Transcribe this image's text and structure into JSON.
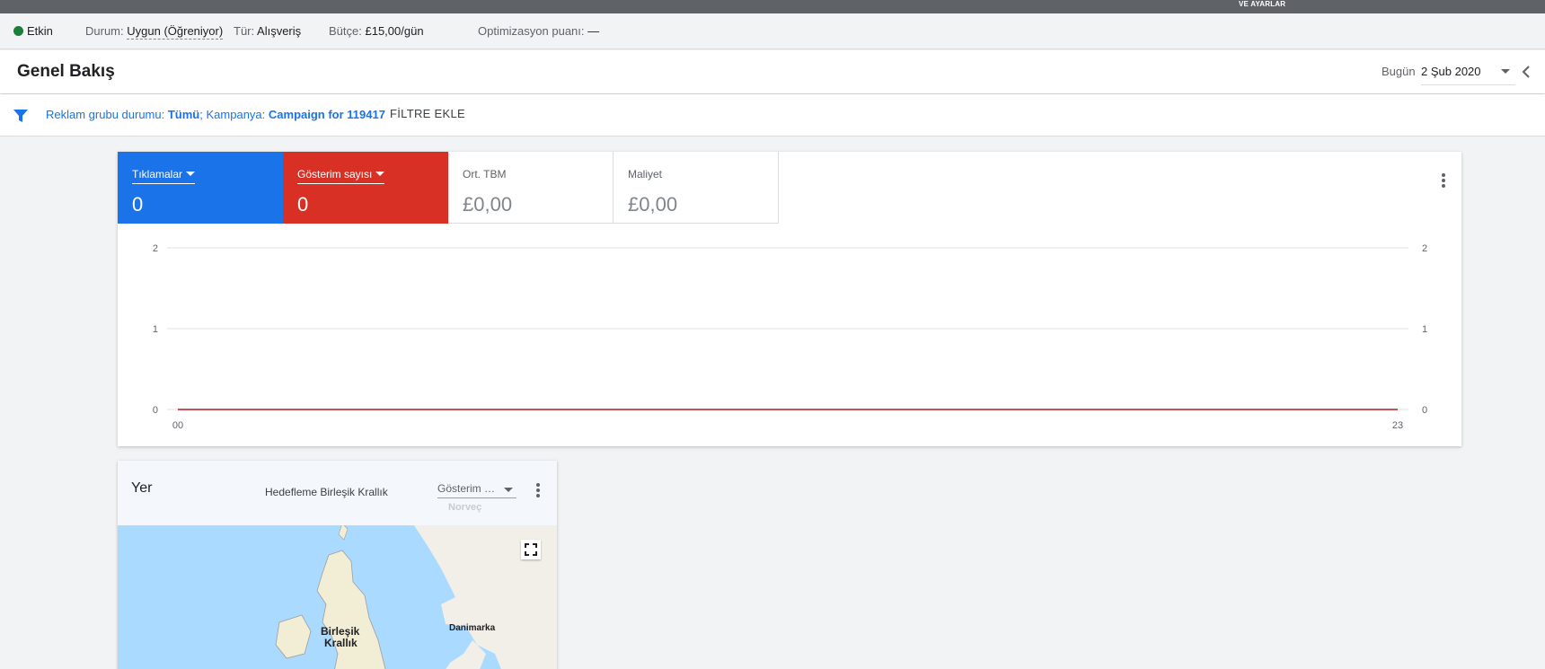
{
  "topbar": {
    "settings_label": "VE AYARLAR"
  },
  "status": {
    "state": "Etkin",
    "state_color": "#188038",
    "durum_label": "Durum:",
    "durum_value": "Uygun (Öğreniyor)",
    "tur_label": "Tür:",
    "tur_value": "Alışveriş",
    "butce_label": "Bütçe:",
    "butce_value": "£15,00/gün",
    "opt_label": "Optimizasyon puanı:",
    "opt_value": "—"
  },
  "header": {
    "title": "Genel Bakış",
    "today_label": "Bugün",
    "date_value": "2 Şub 2020"
  },
  "filter": {
    "ad_group_label": "Reklam grubu durumu:",
    "ad_group_value": "Tümü",
    "sep": ";",
    "campaign_label": "Kampanya:",
    "campaign_value": "Campaign for 119417",
    "add_filter": "FİLTRE EKLE"
  },
  "metrics": [
    {
      "label": "Tıklamalar",
      "value": "0",
      "color": "#1a73e8"
    },
    {
      "label": "Gösterim sayısı",
      "value": "0",
      "color": "#d93025"
    },
    {
      "label": "Ort. TBM",
      "value": "£0,00"
    },
    {
      "label": "Maliyet",
      "value": "£0,00"
    }
  ],
  "chart_data": {
    "type": "line",
    "x": [
      "00",
      "23"
    ],
    "series": [
      {
        "values": [
          0,
          0
        ],
        "color": "#1a73e8"
      },
      {
        "values": [
          0,
          0
        ],
        "color": "#d93025"
      }
    ],
    "ylim": [
      0,
      2
    ],
    "y_ticks": [
      "0",
      "1",
      "2"
    ],
    "y2_ticks": [
      "0",
      "1",
      "2"
    ],
    "x_tick_labels": [
      "00",
      "23"
    ],
    "grid": true
  },
  "map_card": {
    "title": "Yer",
    "targeting": "Hedefleme Birleşik Krallık",
    "metric_select": "Gösterim sayısı",
    "labels": {
      "uk_line1": "Birleşik",
      "uk_line2": "Krallık",
      "denmark": "Danimarka",
      "norway": "Norveç"
    }
  }
}
